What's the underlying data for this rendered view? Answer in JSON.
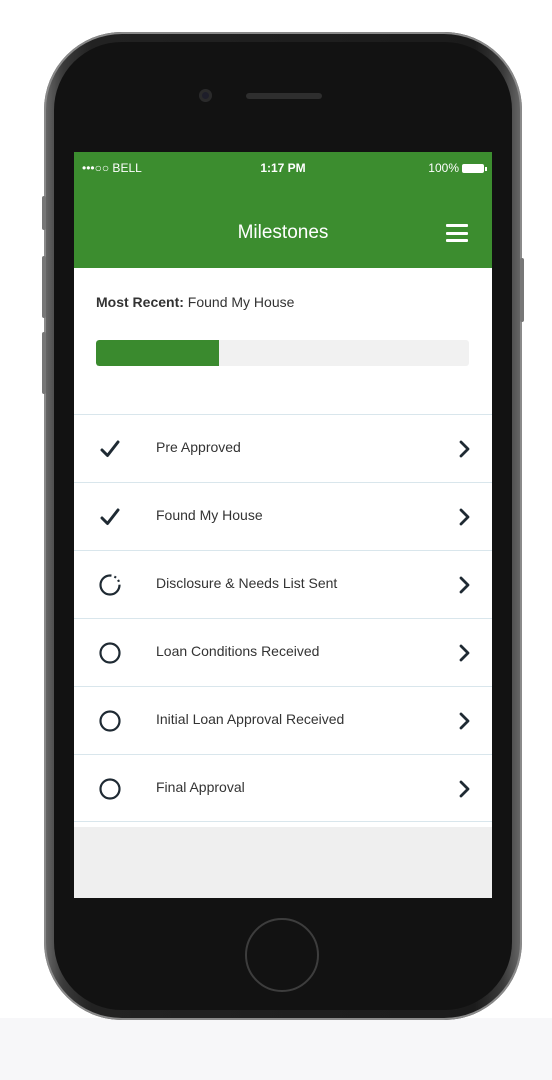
{
  "status_bar": {
    "carrier": "•••○○ BELL",
    "time": "1:17 PM",
    "battery": "100%"
  },
  "header": {
    "title": "Milestones",
    "menu_icon": "hamburger-menu-icon"
  },
  "most_recent": {
    "label": "Most Recent:",
    "value": "Found My House"
  },
  "progress": {
    "fraction": 0.33
  },
  "milestones": [
    {
      "label": "Pre Approved",
      "status": "complete"
    },
    {
      "label": "Found My House",
      "status": "complete"
    },
    {
      "label": "Disclosure & Needs List Sent",
      "status": "in-progress"
    },
    {
      "label": "Loan Conditions Received",
      "status": "pending"
    },
    {
      "label": "Initial Loan Approval Received",
      "status": "pending"
    },
    {
      "label": "Final Approval",
      "status": "pending"
    }
  ],
  "colors": {
    "brand_green": "#3c8d2f",
    "progress_green": "#3a8a2e",
    "divider": "#d9e6ec"
  }
}
